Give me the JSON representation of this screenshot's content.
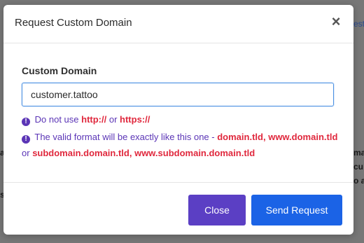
{
  "background": {
    "fragments": [
      "est",
      "a",
      "ma",
      "s",
      "cu",
      "o a"
    ]
  },
  "modal": {
    "title": "Request Custom Domain",
    "close_icon": "×"
  },
  "form": {
    "label": "Custom Domain",
    "value": "customer.tattoo"
  },
  "hints": {
    "hint1": {
      "prefix": "Do not use",
      "http": "http://",
      "or": "or",
      "https": "https://"
    },
    "hint2": {
      "prefix": "The valid format will be exactly like this one -",
      "example1": "domain.tld,",
      "example2": "www.domain.tld",
      "or": "or",
      "example3": "subdomain.domain.tld, www.subdomain.domain.tld"
    }
  },
  "buttons": {
    "close": "Close",
    "send": "Send Request"
  },
  "colors": {
    "accent_purple": "#5b3fc4",
    "primary_blue": "#1b63e6",
    "hint_purple": "#5b35b6",
    "emphasis_red": "#e0283d"
  }
}
